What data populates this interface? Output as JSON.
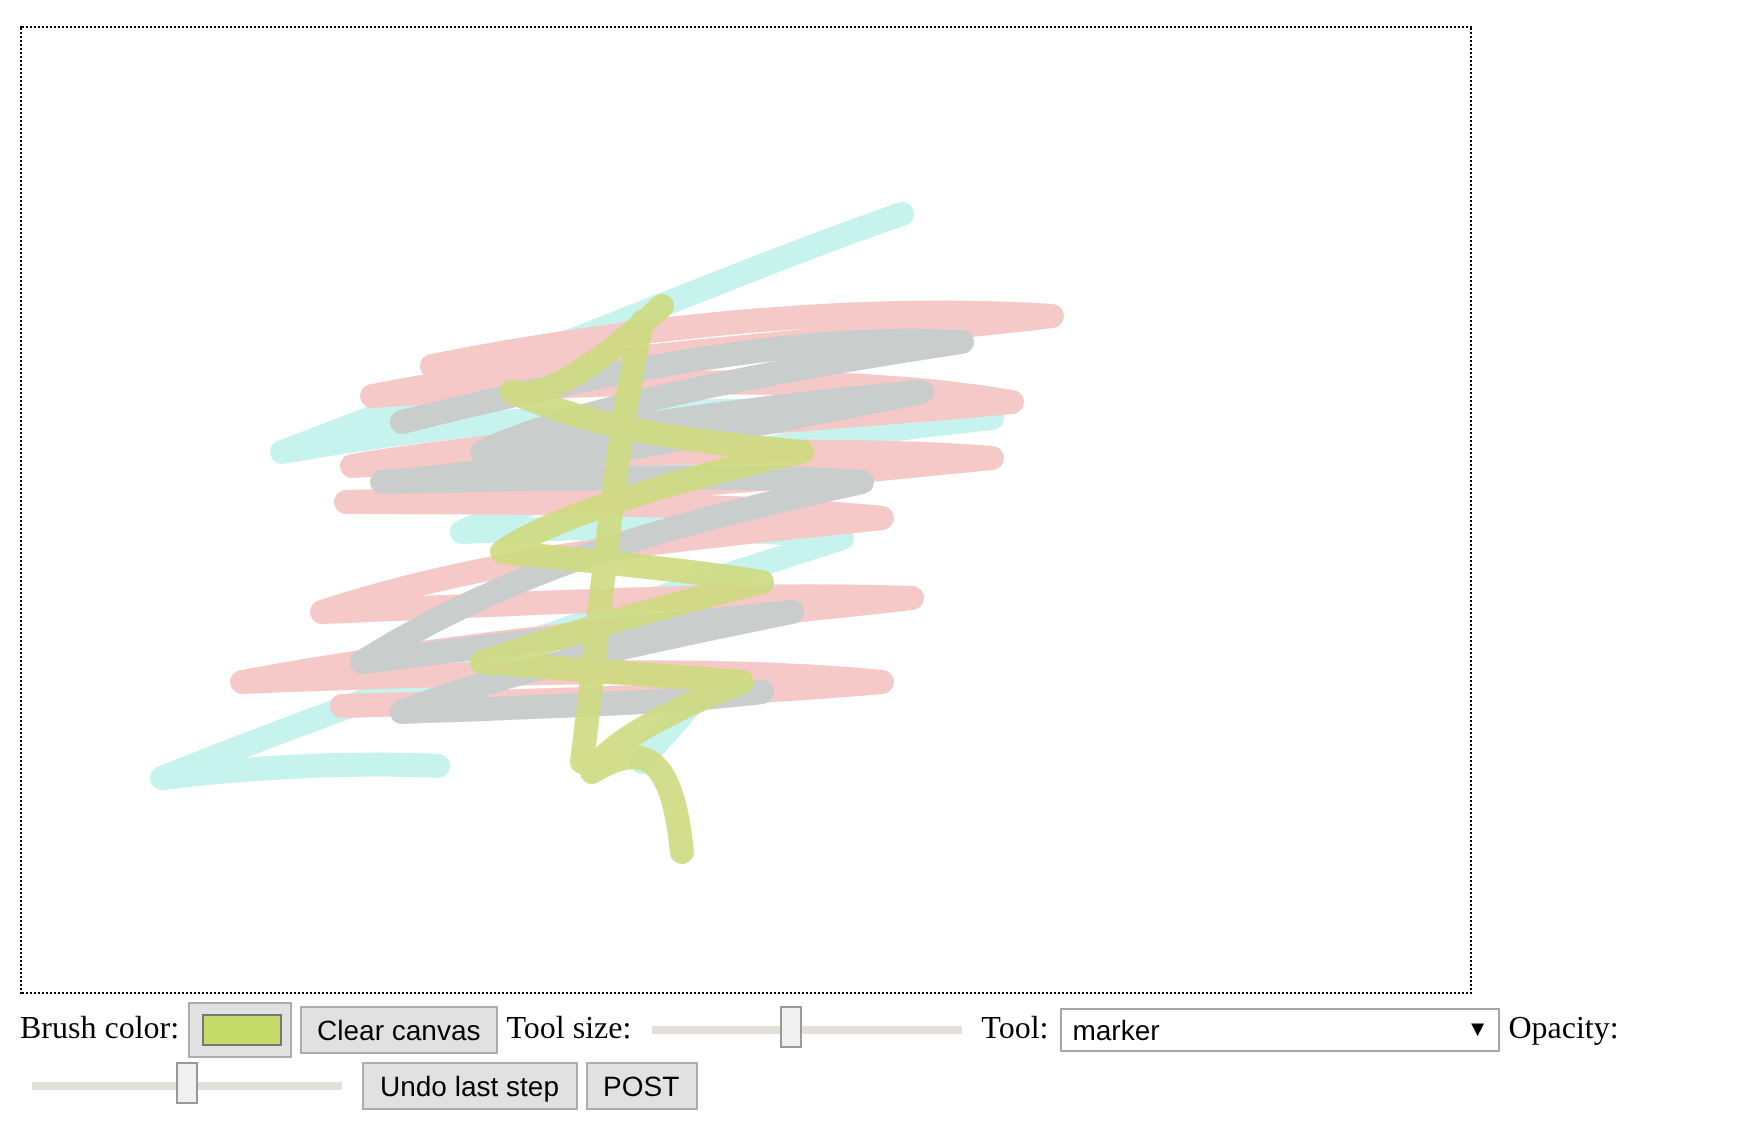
{
  "controls": {
    "brush_color_label": "Brush color:",
    "brush_swatch": {
      "color": "#c5dc6a"
    },
    "clear_button": "Clear canvas",
    "tool_size_label": "Tool size:",
    "tool_size": {
      "level": 0.45
    },
    "tool_label": "Tool:",
    "tool_value": "marker",
    "dropdown_arrow": "▼",
    "opacity_label": "Opacity:",
    "opacity": {
      "level": 0.5
    },
    "undo_button": "Undo last step",
    "post_button": "POST"
  }
}
